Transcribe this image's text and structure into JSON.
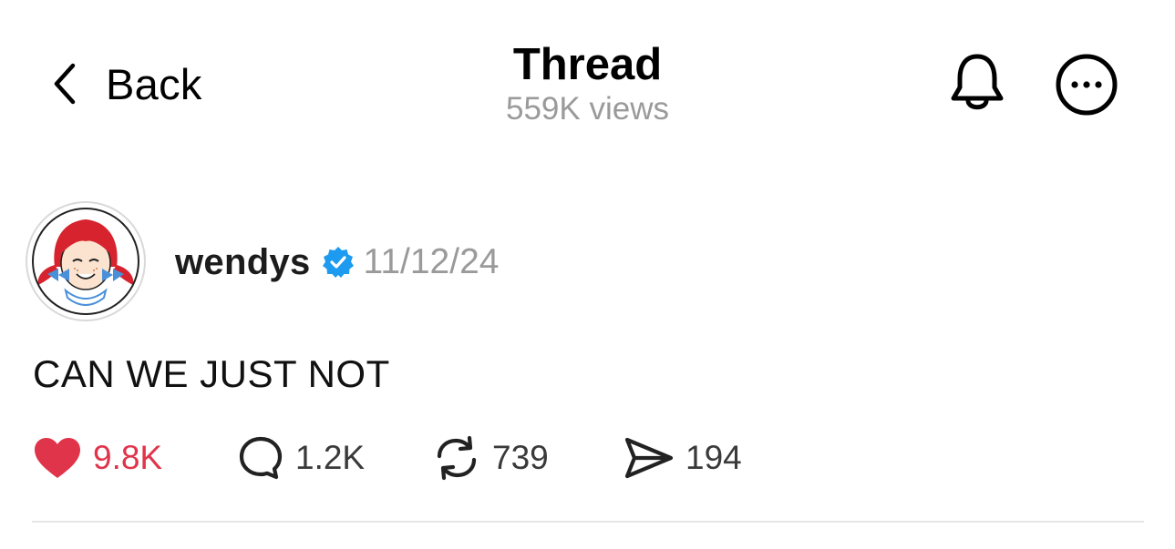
{
  "header": {
    "back_label": "Back",
    "title": "Thread",
    "views": "559K views",
    "icons": [
      "chevron-left-icon",
      "bell-icon",
      "more-icon"
    ]
  },
  "post": {
    "username": "wendys",
    "verified": true,
    "timestamp": "11/12/24",
    "text": "CAN WE JUST NOT",
    "avatar_label": "Wendy's",
    "actions": {
      "likes": "9.8K",
      "replies": "1.2K",
      "reposts": "739",
      "shares": "194"
    }
  },
  "colors": {
    "like_red": "#e0344a",
    "verified_blue": "#1d9bf0",
    "muted_gray": "#9a9a9a"
  }
}
